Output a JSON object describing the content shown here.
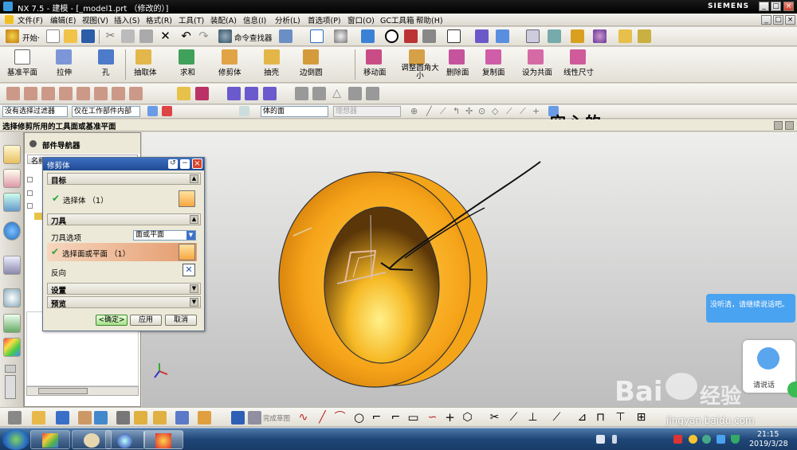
{
  "window": {
    "title": "NX 7.5 - 建模 - [_model1.prt （修改的）]",
    "brand": "SIEMENS"
  },
  "menu": [
    "文件(F)",
    "编辑(E)",
    "视图(V)",
    "插入(S)",
    "格式(R)",
    "工具(T)",
    "装配(A)",
    "信息(I)",
    "分析(L)",
    "首选项(P)",
    "窗口(O)",
    "GC工具箱",
    "帮助(H)"
  ],
  "toolbar1": {
    "start_label": "开始·",
    "cmd_finder_label": "命令查找器"
  },
  "toolbar2": {
    "items": [
      "基准平面",
      "拉伸",
      "孔",
      "抽取体",
      "求和",
      "修剪体",
      "抽壳",
      "边倒圆",
      "移动面",
      "调整圆角大小",
      "删除面",
      "复制面",
      "设为共面",
      "线性尺寸"
    ]
  },
  "selbar": {
    "filter": "没有选择过滤器",
    "scope": "仅在工作部件内部",
    "face_rule": "体的面",
    "disabled_field": "理想器"
  },
  "status": {
    "prompt": "选择修剪所用的工具面或基准平面"
  },
  "annotation": "空心的",
  "navigator": {
    "title": "部件导航器",
    "col_header": "名称"
  },
  "dialog": {
    "title": "修剪体",
    "target_section": "目标",
    "select_body": "选择体 （1）",
    "tool_section": "刀具",
    "tool_option_label": "刀具选项",
    "tool_option_value": "面或平面",
    "select_face": "选择面或平面 （1）",
    "reverse": "反向",
    "settings": "设置",
    "preview": "预览",
    "ok": "<确定>",
    "apply": "应用",
    "cancel": "取消"
  },
  "chat": {
    "bubble": "没听清，请继续说话吧。",
    "voice_label": "请说话"
  },
  "watermark": {
    "brand": "Bai",
    "brand2": "经验",
    "url": "jingyan.baidu.com"
  },
  "bottom_toolbar": {
    "sketch_label": "完成草图"
  },
  "taskbar": {
    "time": "21:15",
    "date": "2019/3/28"
  },
  "colors": {
    "part": "#f5a623",
    "part_dark": "#c0740f",
    "title_bg": "#000000",
    "dialog_header": "#2d5aa8",
    "selected_row": "#e9a06a"
  }
}
